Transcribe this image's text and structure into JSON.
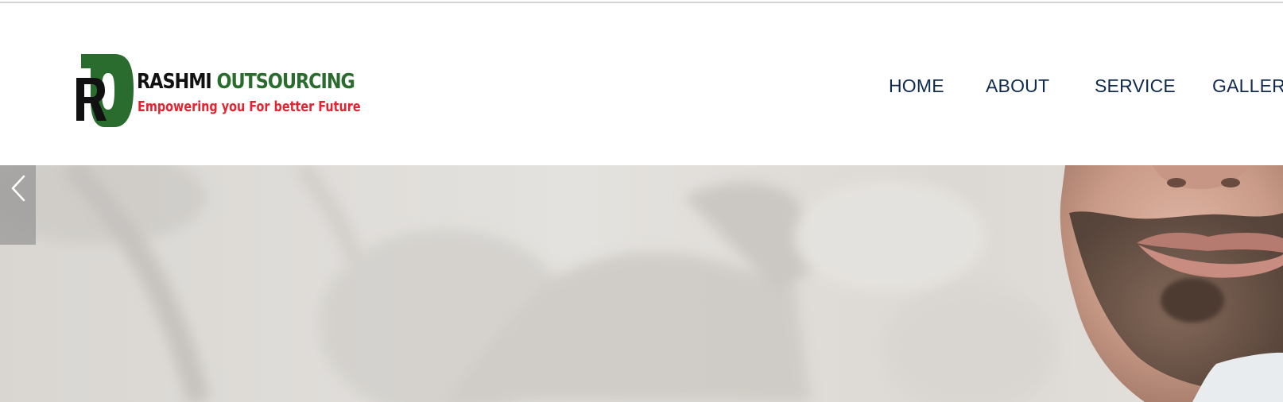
{
  "header": {
    "logo": {
      "monogram": "RO",
      "brand_word_1": "RASHMI",
      "brand_word_2": "OUTSOURCING",
      "tagline": "Empowering you For better Future",
      "colors": {
        "green": "#2a6b2e",
        "black": "#111111",
        "red": "#e52330"
      }
    },
    "nav": {
      "items": [
        {
          "label": "HOME"
        },
        {
          "label": "ABOUT"
        },
        {
          "label": "SERVICE"
        },
        {
          "label": "GALLER"
        }
      ],
      "color": "#0f2a4f"
    }
  },
  "hero": {
    "prev_control_icon": "chevron-left-icon"
  }
}
